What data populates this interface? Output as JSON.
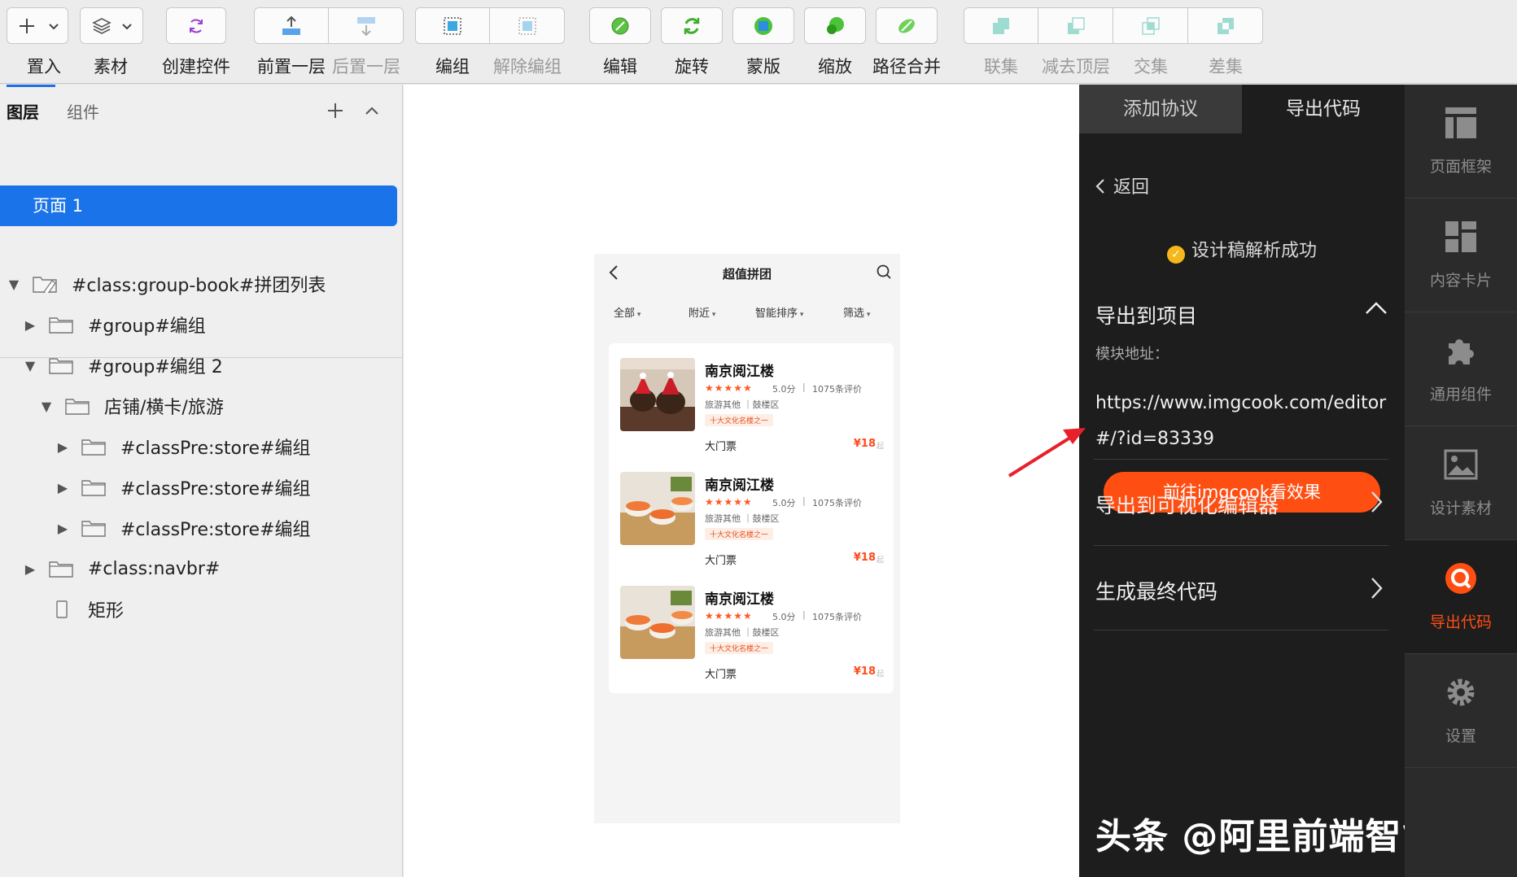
{
  "toolbar": {
    "items": [
      {
        "label": "置入"
      },
      {
        "label": "素材"
      },
      {
        "label": "创建控件"
      },
      {
        "label": "前置一层"
      },
      {
        "label": "后置一层"
      },
      {
        "label": "编组"
      },
      {
        "label": "解除编组"
      },
      {
        "label": "编辑"
      },
      {
        "label": "旋转"
      },
      {
        "label": "蒙版"
      },
      {
        "label": "缩放"
      },
      {
        "label": "路径合并"
      },
      {
        "label": "联集"
      },
      {
        "label": "减去顶层"
      },
      {
        "label": "交集"
      },
      {
        "label": "差集"
      }
    ]
  },
  "left_panel": {
    "tabs": [
      {
        "label": "图层"
      },
      {
        "label": "组件"
      }
    ],
    "pages": [
      {
        "label": "页面 1"
      }
    ],
    "layers": [
      {
        "label": "#class:group-book#拼团列表"
      },
      {
        "label": "#group#编组"
      },
      {
        "label": "#group#编组 2"
      },
      {
        "label": "店铺/横卡/旅游"
      },
      {
        "label": "#classPre:store#编组"
      },
      {
        "label": "#classPre:store#编组"
      },
      {
        "label": "#classPre:store#编组"
      },
      {
        "label": "#class:navbr#"
      },
      {
        "label": "矩形"
      }
    ]
  },
  "phone": {
    "title": "超值拼团",
    "filters": [
      "全部",
      "附近",
      "智能排序",
      "筛选"
    ],
    "cards": [
      {
        "name": "南京阅江楼",
        "stars": "★★★★★",
        "score": "5.0分",
        "sep": "|",
        "reviews": "1075条评价",
        "category": "旅游其他 ｜鼓楼区",
        "tag": "十大文化名楼之一",
        "ticket": "大门票",
        "price": "¥18",
        "price_unit": "起"
      },
      {
        "name": "南京阅江楼",
        "stars": "★★★★★",
        "score": "5.0分",
        "sep": "|",
        "reviews": "1075条评价",
        "category": "旅游其他 ｜鼓楼区",
        "tag": "十大文化名楼之一",
        "ticket": "大门票",
        "price": "¥18",
        "price_unit": "起"
      },
      {
        "name": "南京阅江楼",
        "stars": "★★★★★",
        "score": "5.0分",
        "sep": "|",
        "reviews": "1075条评价",
        "category": "旅游其他 ｜鼓楼区",
        "tag": "十大文化名楼之一",
        "ticket": "大门票",
        "price": "¥18",
        "price_unit": "起"
      }
    ]
  },
  "right_panel": {
    "tabs": [
      {
        "label": "添加协议"
      },
      {
        "label": "导出代码"
      }
    ],
    "back": "返回",
    "success": "设计稿解析成功",
    "export_title": "导出到项目",
    "module_label": "模块地址：",
    "module_url": "https://www.imgcook.com/editor#/?id=83339",
    "goto_button": "前往imgcook看效果",
    "row_visual_editor": "导出到可视化编辑器",
    "row_final_code": "生成最终代码",
    "watermark": "头条 @阿里前端智能化"
  },
  "side_nav": {
    "items": [
      {
        "label": "页面框架",
        "icon": "page-frame-icon"
      },
      {
        "label": "内容卡片",
        "icon": "content-card-icon"
      },
      {
        "label": "通用组件",
        "icon": "puzzle-icon"
      },
      {
        "label": "设计素材",
        "icon": "image-icon"
      },
      {
        "label": "导出代码",
        "icon": "export-code-icon"
      },
      {
        "label": "设置",
        "icon": "gear-icon"
      }
    ]
  },
  "colors": {
    "accent_blue": "#1a73e8",
    "accent_orange": "#ff4e12",
    "dark_panel": "#1d1d1d",
    "arrow_red": "#e8202a"
  }
}
